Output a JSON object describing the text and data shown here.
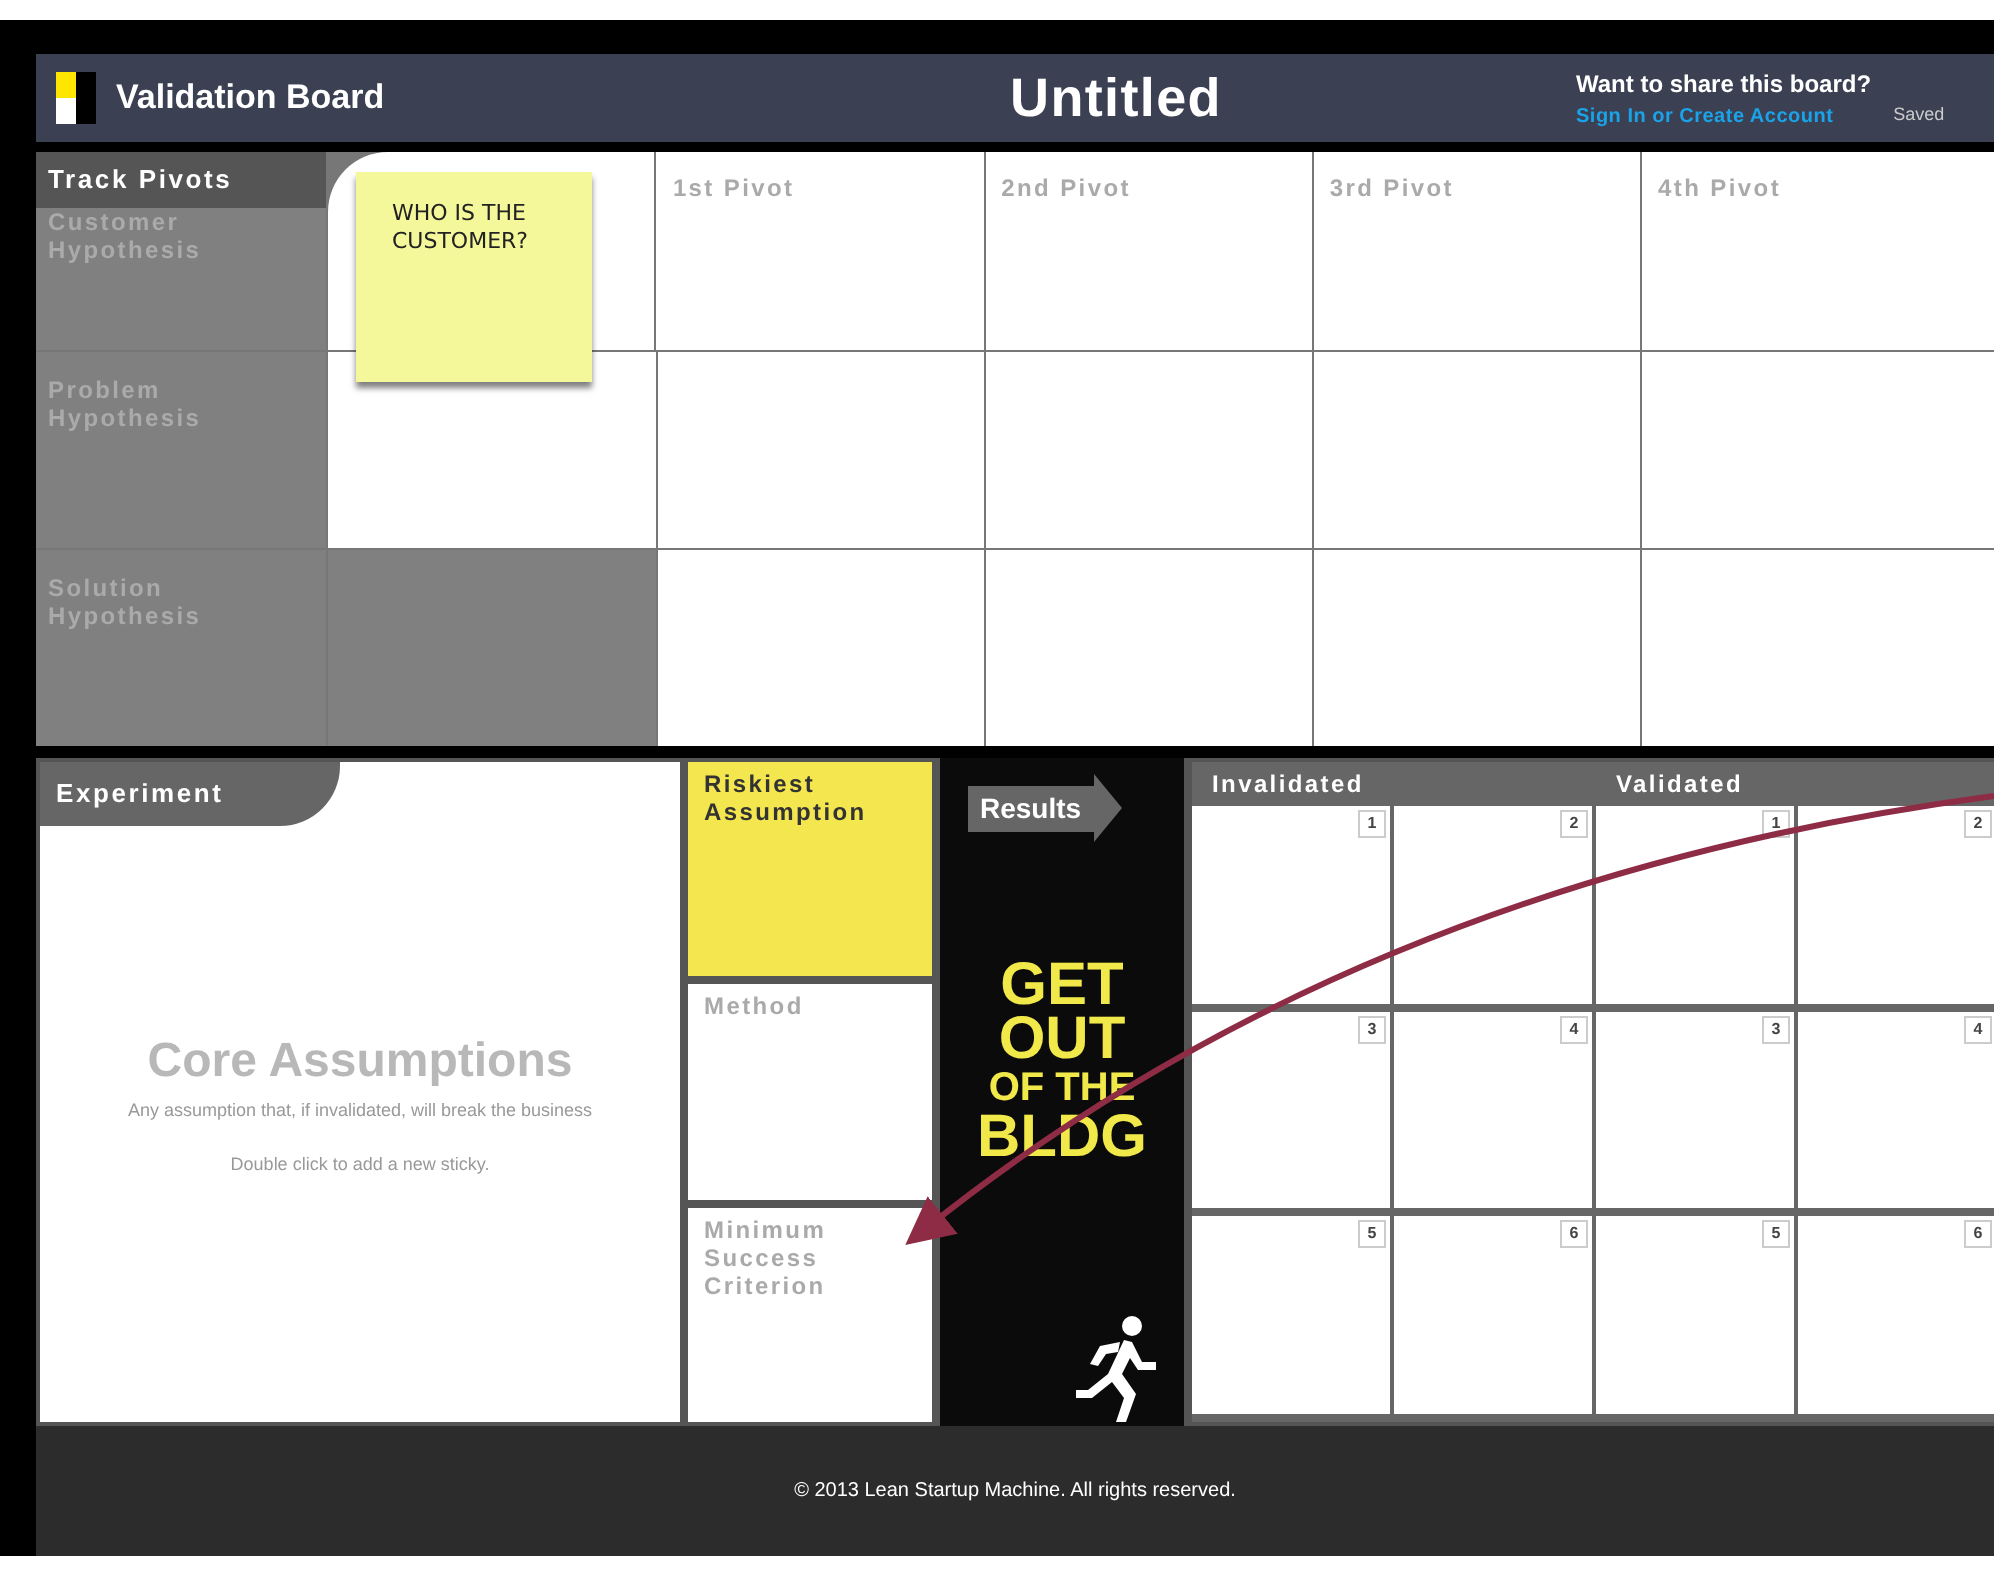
{
  "header": {
    "app_name": "Validation Board",
    "board_title": "Untitled",
    "share_prompt": "Want to share this board?",
    "sign_in_link": "Sign In or Create Account",
    "save_status": "Saved"
  },
  "pivots": {
    "heading": "Track Pivots",
    "columns": [
      {},
      {
        "label": "1st Pivot"
      },
      {
        "label": "2nd Pivot"
      },
      {
        "label": "3rd Pivot"
      },
      {
        "label": "4th Pivot"
      }
    ],
    "rows": [
      {
        "label": "Customer Hypothesis"
      },
      {
        "label": "Problem Hypothesis"
      },
      {
        "label": "Solution Hypothesis"
      }
    ],
    "sticky": {
      "text": "WHO IS THE CUSTOMER?"
    }
  },
  "experiment": {
    "heading": "Experiment",
    "placeholder_title": "Core Assumptions",
    "placeholder_subtitle": "Any assumption that, if invalidated, will break the business",
    "hint": "Double click to add a new sticky."
  },
  "steps": [
    {
      "label": "Riskiest Assumption",
      "highlighted": true
    },
    {
      "label": "Method",
      "highlighted": false
    },
    {
      "label": "Minimum Success Criterion",
      "highlighted": false
    }
  ],
  "results": {
    "arrow_label": "Results",
    "slogan": [
      "GET",
      "OUT",
      "OF THE",
      "BLDG"
    ],
    "headings": [
      "Invalidated",
      "Validated"
    ],
    "rows": [
      [
        "1",
        "2",
        "1",
        "2"
      ],
      [
        "3",
        "4",
        "3",
        "4"
      ],
      [
        "5",
        "6",
        "5",
        "6"
      ]
    ]
  },
  "footer": {
    "copyright": "© 2013 Lean Startup Machine. All rights reserved."
  }
}
